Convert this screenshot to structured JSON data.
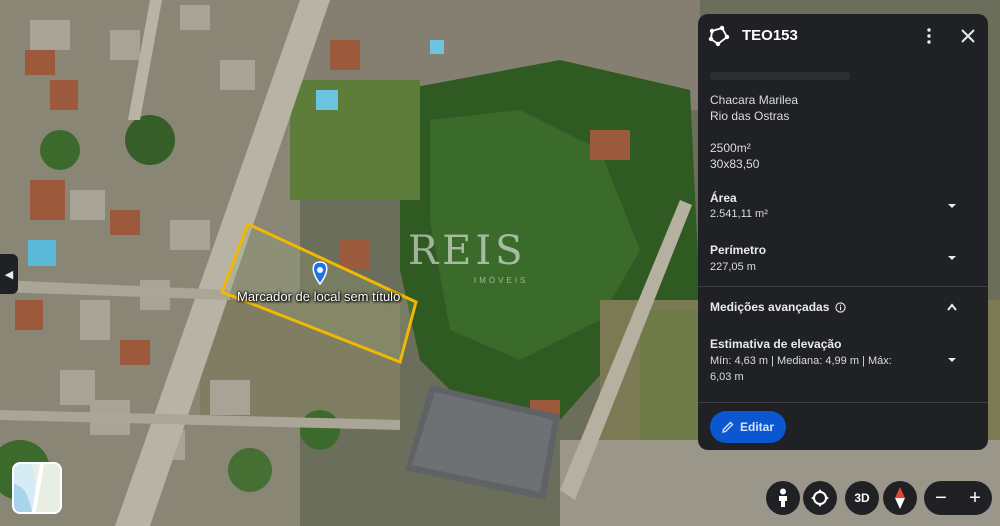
{
  "map": {
    "marker_label": "Marcador de local sem título",
    "watermark_text": "REIS",
    "watermark_subtext": "IMÓVEIS",
    "parcel_outline_color": "#f2b705",
    "marker_color": "#1a73e8"
  },
  "panel": {
    "title": "TEO153",
    "shape_icon": "polygon-icon",
    "description": [
      "Chacara Marilea",
      "Rio das Ostras",
      "2500m²",
      "30x83,50"
    ],
    "area": {
      "label": "Área",
      "value": "2.541,11 m²"
    },
    "perimeter": {
      "label": "Perímetro",
      "value": "227,05 m"
    },
    "advanced": {
      "label": "Medições avançadas",
      "info_icon": "info-icon"
    },
    "elevation": {
      "label": "Estimativa de elevação",
      "line1": "Mín: 4,63 m | Mediana: 4,99 m | Máx:",
      "line2": "6,03 m"
    },
    "edit_label": "Editar"
  },
  "controls": {
    "pegman_icon": "pegman-icon",
    "tilt_icon": "rotate-icon",
    "label_3d": "3D",
    "compass_icon": "compass-icon",
    "zoom_out": "−",
    "zoom_in": "+"
  },
  "colors": {
    "panel_bg": "#202124",
    "accent": "#0b57d0"
  }
}
